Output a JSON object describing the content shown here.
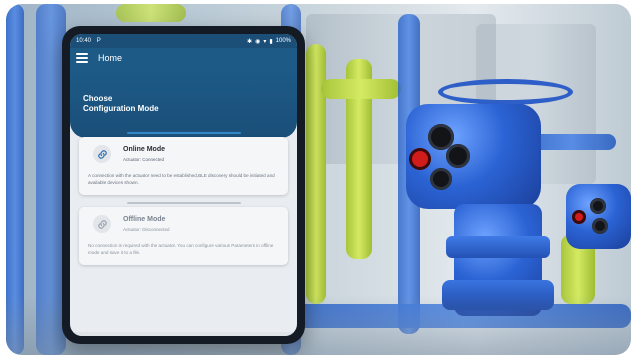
{
  "status_bar": {
    "time": "10:40",
    "app_indicator": "P",
    "battery": "100%"
  },
  "app_bar": {
    "title": "Home"
  },
  "header": {
    "title": "Choose\nConfiguration Mode"
  },
  "modes": [
    {
      "title": "Online Mode",
      "status": "Actuator: Connected",
      "description": "A connection with the actuator need to be established,BLE discovery should be initiated and available devices shown."
    },
    {
      "title": "Offline Mode",
      "status": "Actuator: Disconnected",
      "description": "No connection is required with the actuator. You can configure various Parameters in offline mode and save it to a file."
    }
  ],
  "icons": {
    "menu": "hamburger-menu-icon",
    "link": "link-icon",
    "bluetooth": "bluetooth-icon",
    "wifi": "wifi-icon",
    "battery": "battery-icon",
    "eye": "eye-icon"
  },
  "colors": {
    "header_blue": "#1d5a86",
    "accent_blue": "#2f86c7",
    "actuator_blue": "#2b63d4",
    "pipe_yellow": "#c8e14f"
  }
}
